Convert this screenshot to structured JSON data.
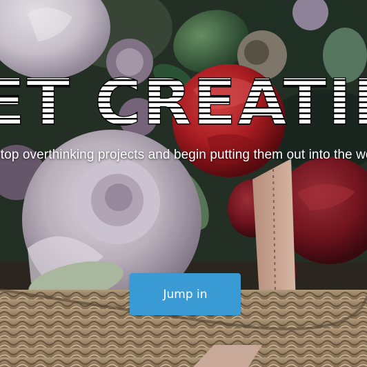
{
  "hero": {
    "headline": "GET CREATING",
    "tagline": "Stop overthinking projects and begin putting them out into the world.",
    "cta_label": "Jump in",
    "image_alt": "Bouquet of roses and flowers in a woven basket"
  },
  "colors": {
    "cta": "#3a9bd4",
    "cta_text": "#ffffff",
    "headline_fill": "#ffffff",
    "headline_stripe": "#000000"
  }
}
